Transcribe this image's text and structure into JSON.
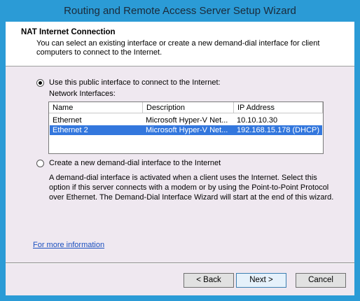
{
  "window": {
    "title": "Routing and Remote Access Server Setup Wizard"
  },
  "header": {
    "title": "NAT Internet Connection",
    "subtitle": "You can select an existing interface or create a new demand-dial interface for client computers to connect to the Internet."
  },
  "option_public": {
    "label": "Use this public interface to connect to the Internet:",
    "selected": true
  },
  "interfaces": {
    "label": "Network Interfaces:",
    "columns": [
      "Name",
      "Description",
      "IP Address"
    ],
    "rows": [
      {
        "name": "Ethernet",
        "description": "Microsoft Hyper-V Net...",
        "ip": "10.10.10.30",
        "selected": false
      },
      {
        "name": "Ethernet 2",
        "description": "Microsoft Hyper-V Net...",
        "ip": "192.168.15.178 (DHCP)",
        "selected": true
      }
    ]
  },
  "option_demand": {
    "label": "Create a new demand-dial interface to the Internet",
    "selected": false,
    "description": "A demand-dial interface is activated when a client uses the Internet. Select this option if this server connects with a modem or by using the Point-to-Point Protocol over Ethernet. The Demand-Dial Interface Wizard will start at the end of this wizard."
  },
  "link": "For more information",
  "buttons": {
    "back": "< Back",
    "next": "Next >",
    "cancel": "Cancel"
  }
}
